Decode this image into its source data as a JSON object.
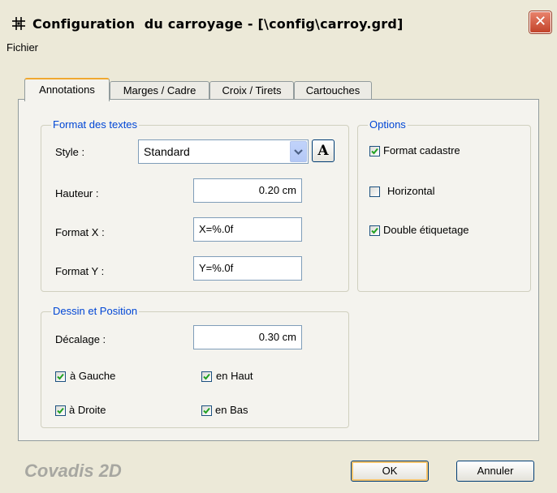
{
  "window": {
    "title": "Configuration  du carroyage - [\\config\\carroy.grd]",
    "close_label": "✕"
  },
  "menu": {
    "items": [
      "Fichier"
    ]
  },
  "tabs": [
    {
      "label": "Annotations",
      "active": true
    },
    {
      "label": "Marges / Cadre",
      "active": false
    },
    {
      "label": "Croix / Tirets",
      "active": false
    },
    {
      "label": "Cartouches",
      "active": false
    }
  ],
  "format_textes": {
    "title": "Format des textes",
    "style_label": "Style :",
    "style_value": "Standard",
    "font_button_label": "A",
    "hauteur_label": "Hauteur :",
    "hauteur_value": "0.20 cm",
    "format_x_label": "Format X :",
    "format_x_value": "X=%.0f",
    "format_y_label": "Format Y :",
    "format_y_value": "Y=%.0f"
  },
  "options": {
    "title": "Options",
    "items": [
      {
        "label": "Format cadastre",
        "checked": true
      },
      {
        "label": "Horizontal",
        "checked": false
      },
      {
        "label": "Double étiquetage",
        "checked": true
      }
    ]
  },
  "dessin_position": {
    "title": "Dessin et Position",
    "decalage_label": "Décalage :",
    "decalage_value": "0.30 cm",
    "checks": [
      {
        "label": "à Gauche",
        "checked": true
      },
      {
        "label": "en Haut",
        "checked": true
      },
      {
        "label": "à Droite",
        "checked": true
      },
      {
        "label": "en Bas",
        "checked": true
      }
    ]
  },
  "footer": {
    "brand": "Covadis 2D",
    "ok_label": "OK",
    "cancel_label": "Annuler"
  },
  "colors": {
    "group_title": "#0046d5",
    "dialog_bg": "#ece9d8",
    "check_mark": "#21a121",
    "close_button": "#c2432a"
  }
}
